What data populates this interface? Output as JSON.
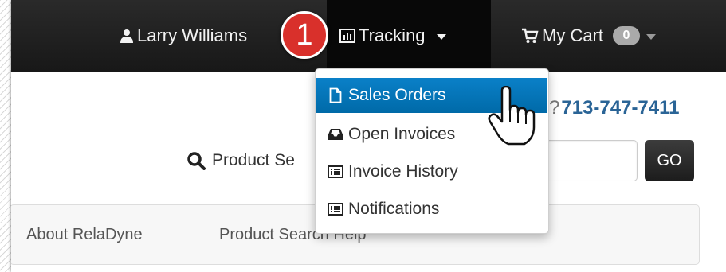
{
  "navbar": {
    "user_name": "Larry Williams",
    "tracking_label": "Tracking",
    "cart_label": "My Cart",
    "cart_count": "0"
  },
  "callout": {
    "step_number": "1"
  },
  "contact": {
    "prefix": "?",
    "phone": "713-747-7411"
  },
  "search": {
    "label": "Product Se",
    "go_label": "GO"
  },
  "tracking_menu": {
    "items": [
      {
        "label": "Sales Orders",
        "icon": "document-icon"
      },
      {
        "label": "Open Invoices",
        "icon": "inbox-icon"
      },
      {
        "label": "Invoice History",
        "icon": "list-icon"
      },
      {
        "label": "Notifications",
        "icon": "list-icon"
      }
    ]
  },
  "subnav": {
    "items": [
      {
        "label": "About RelaDyne"
      },
      {
        "label": "Product Search Help"
      }
    ]
  },
  "colors": {
    "navbar": "#1c1c1c",
    "menu_active": "#0a7cc3",
    "phone": "#2a6496",
    "callout": "#d9302b"
  }
}
